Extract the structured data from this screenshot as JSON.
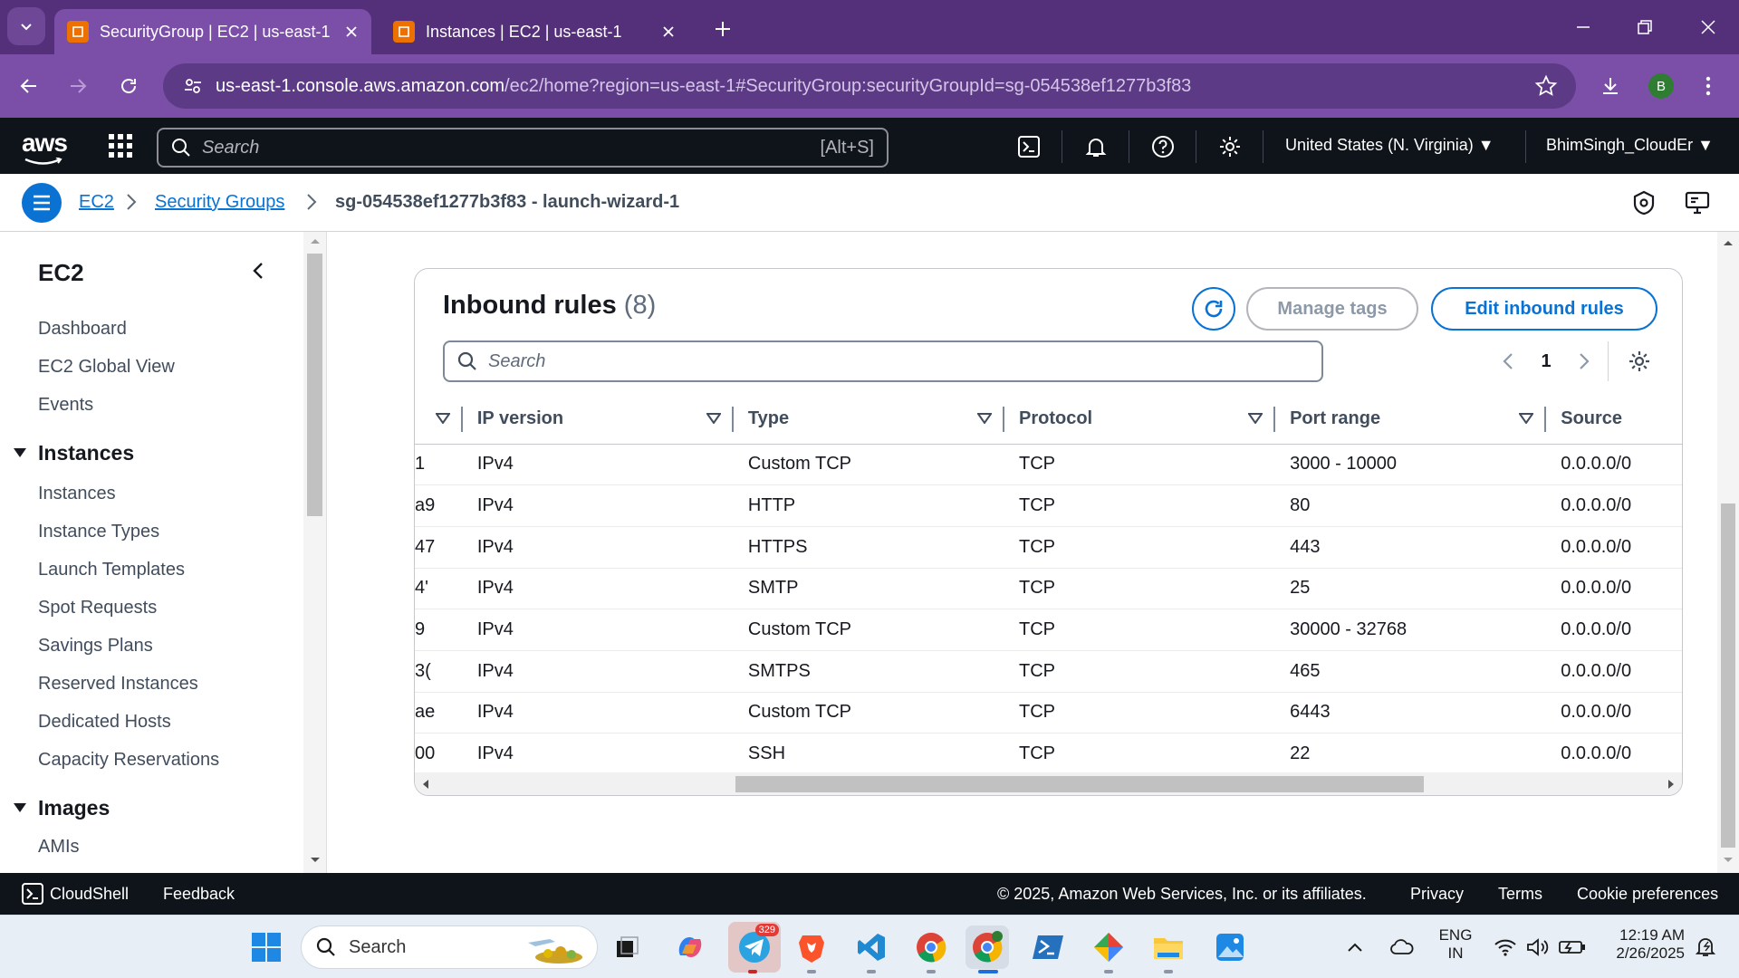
{
  "browser": {
    "tabs": [
      {
        "title": "SecurityGroup | EC2 | us-east-1",
        "active": true
      },
      {
        "title": "Instances | EC2 | us-east-1",
        "active": false
      }
    ],
    "url_host": "us-east-1.console.aws.amazon.com",
    "url_path": "/ec2/home?region=us-east-1#SecurityGroup:securityGroupId=sg-054538ef1277b3f83",
    "profile_initial": "B"
  },
  "aws_header": {
    "logo": "aws",
    "search_placeholder": "Search",
    "search_shortcut": "[Alt+S]",
    "region": "United States (N. Virginia)",
    "user": "BhimSingh_CloudEr"
  },
  "breadcrumb": {
    "items": [
      "EC2",
      "Security Groups"
    ],
    "current": "sg-054538ef1277b3f83 - launch-wizard-1"
  },
  "sidebar": {
    "title": "EC2",
    "top_items": [
      "Dashboard",
      "EC2 Global View",
      "Events"
    ],
    "groups": [
      {
        "label": "Instances",
        "items": [
          "Instances",
          "Instance Types",
          "Launch Templates",
          "Spot Requests",
          "Savings Plans",
          "Reserved Instances",
          "Dedicated Hosts",
          "Capacity Reservations"
        ]
      },
      {
        "label": "Images",
        "items": [
          "AMIs"
        ]
      }
    ]
  },
  "inbound_rules": {
    "title": "Inbound rules",
    "count": "(8)",
    "manage_tags_label": "Manage tags",
    "edit_label": "Edit inbound rules",
    "search_placeholder": "Search",
    "page": "1",
    "columns": [
      "IP version",
      "Type",
      "Protocol",
      "Port range",
      "Source"
    ],
    "rows": [
      {
        "id_tail": "1",
        "ip_version": "IPv4",
        "type": "Custom TCP",
        "protocol": "TCP",
        "port_range": "3000 - 10000",
        "source": "0.0.0.0/0"
      },
      {
        "id_tail": "a9",
        "ip_version": "IPv4",
        "type": "HTTP",
        "protocol": "TCP",
        "port_range": "80",
        "source": "0.0.0.0/0"
      },
      {
        "id_tail": "47",
        "ip_version": "IPv4",
        "type": "HTTPS",
        "protocol": "TCP",
        "port_range": "443",
        "source": "0.0.0.0/0"
      },
      {
        "id_tail": "'4",
        "ip_version": "IPv4",
        "type": "SMTP",
        "protocol": "TCP",
        "port_range": "25",
        "source": "0.0.0.0/0"
      },
      {
        "id_tail": "9",
        "ip_version": "IPv4",
        "type": "Custom TCP",
        "protocol": "TCP",
        "port_range": "30000 - 32768",
        "source": "0.0.0.0/0"
      },
      {
        "id_tail": ")3",
        "ip_version": "IPv4",
        "type": "SMTPS",
        "protocol": "TCP",
        "port_range": "465",
        "source": "0.0.0.0/0"
      },
      {
        "id_tail": "ae",
        "ip_version": "IPv4",
        "type": "Custom TCP",
        "protocol": "TCP",
        "port_range": "6443",
        "source": "0.0.0.0/0"
      },
      {
        "id_tail": "00",
        "ip_version": "IPv4",
        "type": "SSH",
        "protocol": "TCP",
        "port_range": "22",
        "source": "0.0.0.0/0"
      }
    ]
  },
  "footer": {
    "cloudshell": "CloudShell",
    "feedback": "Feedback",
    "copyright": "© 2025, Amazon Web Services, Inc. or its affiliates.",
    "privacy": "Privacy",
    "terms": "Terms",
    "cookie": "Cookie preferences"
  },
  "taskbar": {
    "search_placeholder": "Search",
    "telegram_badge": "329",
    "lang_line1": "ENG",
    "lang_line2": "IN",
    "time": "12:19 AM",
    "date": "2/26/2025"
  }
}
